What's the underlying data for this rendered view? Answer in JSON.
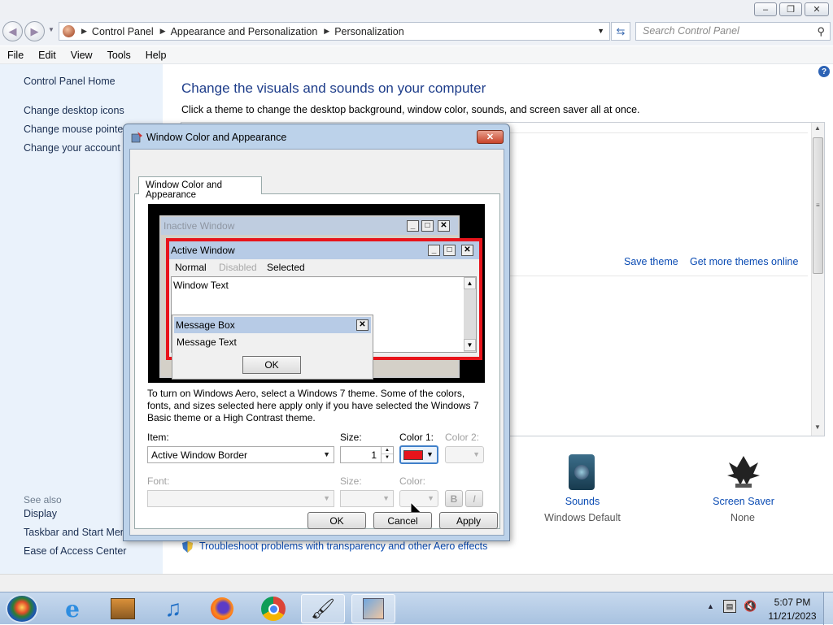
{
  "window": {
    "min_label": "‒",
    "max_label": "❐",
    "close_label": "✕"
  },
  "address": {
    "crumbs": [
      "Control Panel",
      "Appearance and Personalization",
      "Personalization"
    ],
    "search_placeholder": "Search Control Panel"
  },
  "menu": [
    "File",
    "Edit",
    "View",
    "Tools",
    "Help"
  ],
  "leftpane": {
    "home": "Control Panel Home",
    "links": [
      "Change desktop icons",
      "Change mouse pointers",
      "Change your account picture"
    ],
    "see_also": "See also",
    "see_also_links": [
      "Display",
      "Taskbar and Start Menu",
      "Ease of Access Center"
    ]
  },
  "main": {
    "title": "Change the visuals and sounds on your computer",
    "subtitle": "Click a theme to change the desktop background, window color, sounds, and screen saver all at once.",
    "save_theme": "Save theme",
    "get_more": "Get more themes online",
    "sounds_label": "Sounds",
    "sounds_value": "Windows Default",
    "screensaver_label": "Screen Saver",
    "screensaver_value": "None",
    "troubleshoot": "Troubleshoot problems with transparency and other Aero effects"
  },
  "dialog": {
    "title": "Window Color and Appearance",
    "tab": "Window Color and Appearance",
    "preview": {
      "inactive": "Inactive Window",
      "active": "Active Window",
      "normal": "Normal",
      "disabled": "Disabled",
      "selected": "Selected",
      "window_text": "Window Text",
      "msgbox": "Message Box",
      "msgtext": "Message Text",
      "ok": "OK"
    },
    "info": "To turn on Windows Aero, select a Windows 7 theme.  Some of the colors, fonts, and sizes selected here apply only if you have selected the Windows 7 Basic theme or a High Contrast theme.",
    "item_label": "Item:",
    "item_value": "Active Window Border",
    "size_label": "Size:",
    "size_value": "1",
    "color1_label": "Color 1:",
    "color1_value": "#e8141b",
    "color2_label": "Color 2:",
    "font_label": "Font:",
    "fsize_label": "Size:",
    "fcolor_label": "Color:",
    "bold": "B",
    "italic": "I",
    "ok": "OK",
    "cancel": "Cancel",
    "apply": "Apply"
  },
  "taskbar": {
    "time": "5:07 PM",
    "date": "11/21/2023"
  }
}
